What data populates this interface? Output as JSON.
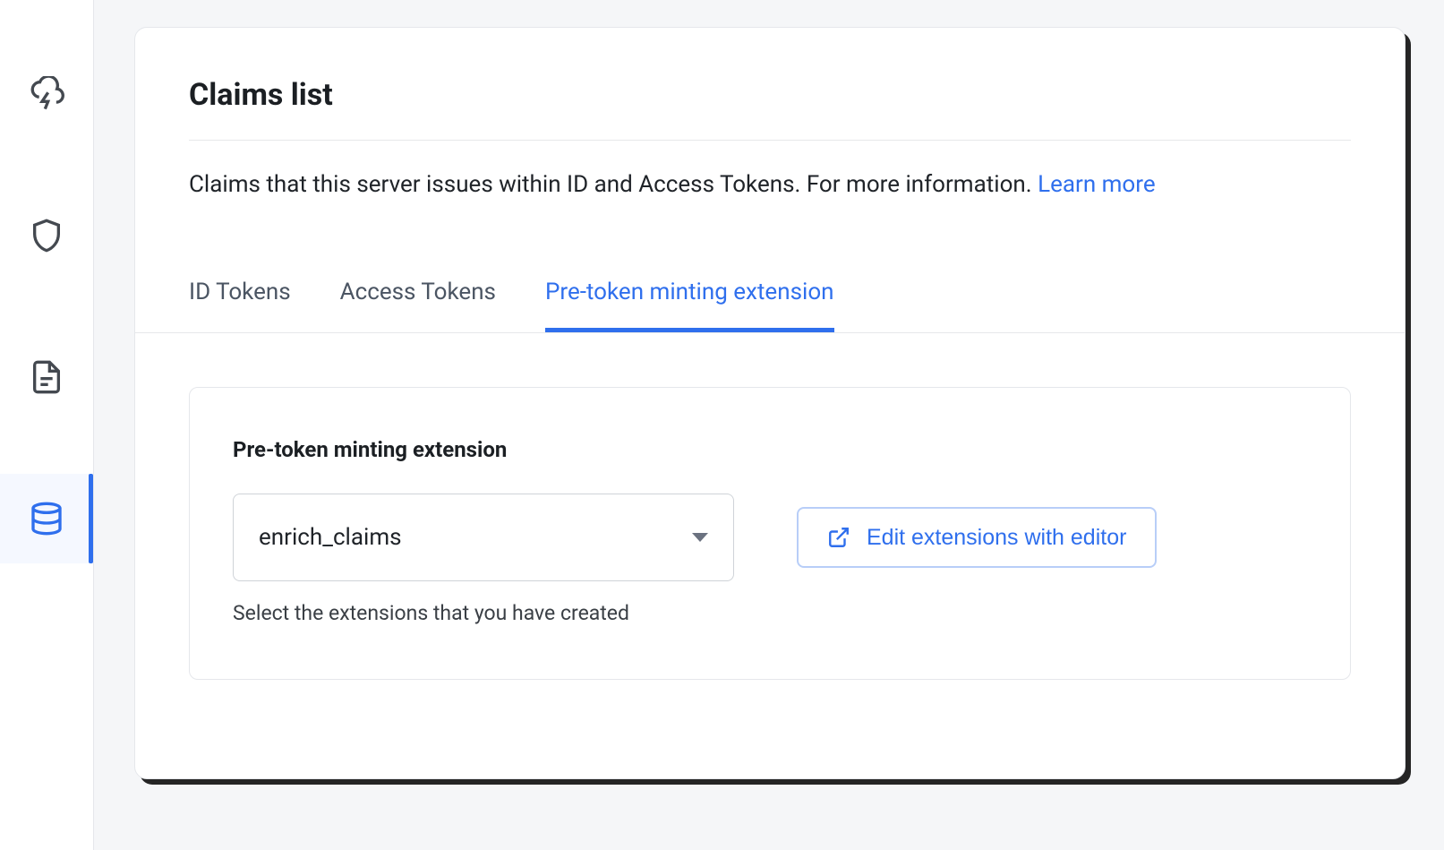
{
  "sidebar": {
    "items": [
      {
        "name": "actions",
        "icon": "thunder-cloud-icon",
        "active": false
      },
      {
        "name": "security",
        "icon": "shield-icon",
        "active": false
      },
      {
        "name": "documents",
        "icon": "document-icon",
        "active": false
      },
      {
        "name": "database",
        "icon": "database-icon",
        "active": true
      }
    ]
  },
  "page": {
    "title": "Claims list",
    "description": "Claims that this server issues within ID and Access Tokens. For more information. ",
    "learn_more_label": "Learn more"
  },
  "tabs": [
    {
      "label": "ID Tokens",
      "active": false
    },
    {
      "label": "Access Tokens",
      "active": false
    },
    {
      "label": "Pre-token minting extension",
      "active": true
    }
  ],
  "panel": {
    "field_label": "Pre-token minting extension",
    "select_value": "enrich_claims",
    "edit_button_label": "Edit extensions with editor",
    "helper_text": "Select the extensions that you have created"
  }
}
